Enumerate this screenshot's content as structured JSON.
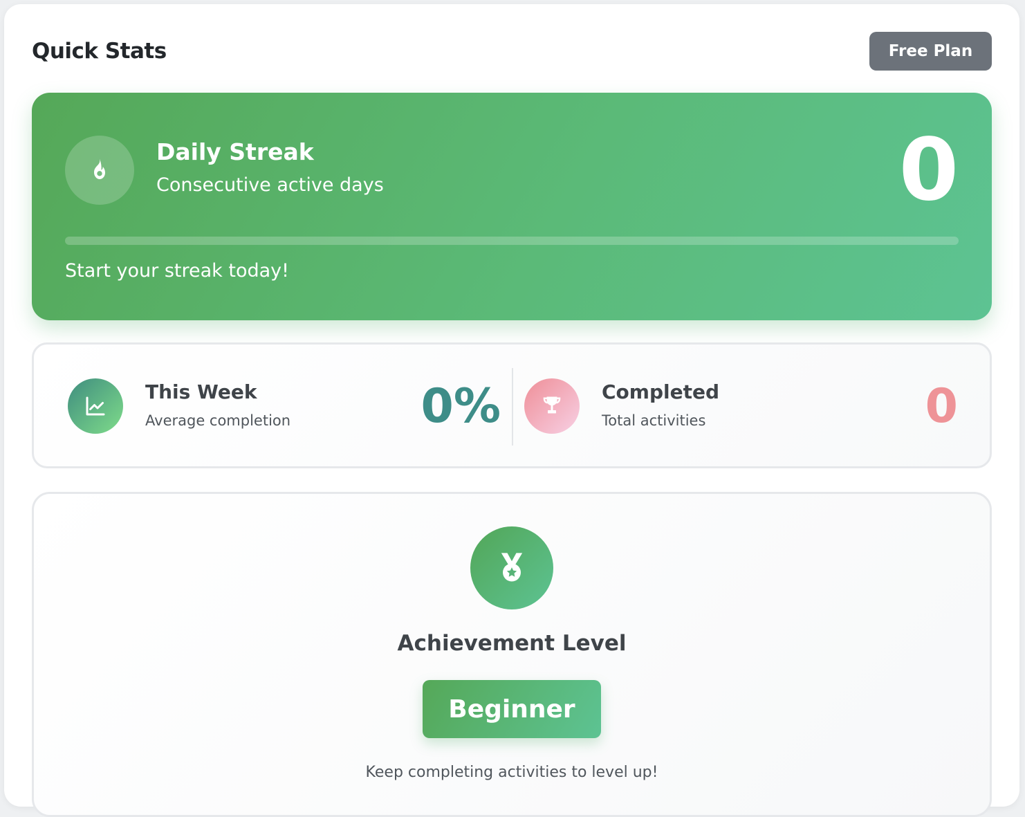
{
  "header": {
    "title": "Quick Stats",
    "plan_badge": "Free Plan"
  },
  "streak": {
    "icon": "fire-icon",
    "title": "Daily Streak",
    "subtitle": "Consecutive active days",
    "value": "0",
    "progress": 0,
    "message": "Start your streak today!"
  },
  "week": {
    "icon": "chart-line-icon",
    "title": "This Week",
    "subtitle": "Average completion",
    "value": "0%",
    "color": "#3e8d88"
  },
  "completed": {
    "icon": "trophy-icon",
    "title": "Completed",
    "subtitle": "Total activities",
    "value": "0",
    "color": "#ee9397"
  },
  "achievement": {
    "icon": "medal-icon",
    "title": "Achievement Level",
    "level": "Beginner",
    "message": "Keep completing activities to level up!"
  },
  "colors": {
    "primary_green": "#55a858",
    "accent_green": "#5dc393",
    "badge_gray": "#6c727a"
  }
}
